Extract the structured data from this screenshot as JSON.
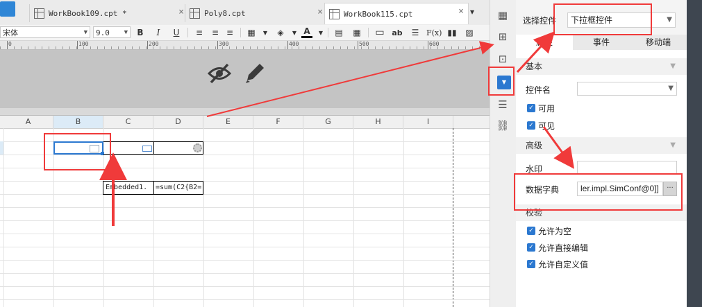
{
  "tabs": [
    {
      "label": "WorkBook109.cpt *",
      "active": false
    },
    {
      "label": "Poly8.cpt",
      "active": false
    },
    {
      "label": "WorkBook115.cpt",
      "active": true
    }
  ],
  "close_symbol": "×",
  "format_toolbar": {
    "font_name": "宋体",
    "font_size": "9.0",
    "bold": "B",
    "italic": "I",
    "underline": "U",
    "text_tool": "ab",
    "formula_tool": "F(x)"
  },
  "ruler": {
    "labels": [
      "0",
      "100",
      "200",
      "300",
      "400",
      "500",
      "600"
    ]
  },
  "grid": {
    "columns": [
      "A",
      "B",
      "C",
      "D",
      "E",
      "F",
      "G",
      "H",
      "I"
    ],
    "selected_column": "B",
    "cells": {
      "c4": "Embedded1.",
      "d4": "=sum(C2{B2="
    }
  },
  "panel": {
    "select_control_label": "选择控件",
    "select_control_value": "下拉框控件",
    "tabs": [
      "属性",
      "事件",
      "移动端"
    ],
    "active_tab": "属性",
    "sections": {
      "basic": "基本",
      "advanced": "高级",
      "validation": "校验"
    },
    "control_name_label": "控件名",
    "control_name_value": "",
    "enabled_label": "可用",
    "visible_label": "可见",
    "watermark_label": "水印",
    "watermark_value": "",
    "data_dictionary_label": "数据字典",
    "data_dictionary_value": "ler.impl.SimConf@0]]",
    "data_dictionary_button": "···",
    "allow_empty_label": "允许为空",
    "allow_direct_edit_label": "允许直接编辑",
    "allow_custom_value_label": "允许自定义值"
  },
  "icons": {
    "hide": "eye-slash-icon",
    "edit": "pencil-icon",
    "checkbox_mark": "✓"
  },
  "colors": {
    "annotation_red": "#f03a3a",
    "accent_blue": "#2b78d0"
  }
}
